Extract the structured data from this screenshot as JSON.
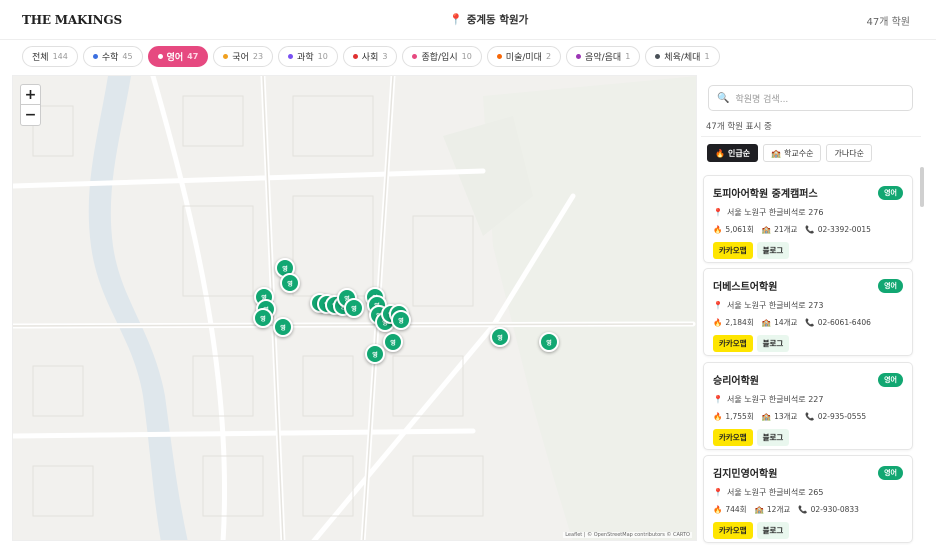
{
  "header": {
    "logo": "THE MAKINGS",
    "location": "중계동 학원가",
    "count": "47개 학원"
  },
  "filters": [
    {
      "label": "전체",
      "count": "144",
      "color": "",
      "active": false
    },
    {
      "label": "수학",
      "count": "45",
      "color": "#3b6fe0",
      "active": false
    },
    {
      "label": "영어",
      "count": "47",
      "color": "#12a772",
      "active": true
    },
    {
      "label": "국어",
      "count": "23",
      "color": "#f0a020",
      "active": false
    },
    {
      "label": "과학",
      "count": "10",
      "color": "#7950f2",
      "active": false
    },
    {
      "label": "사회",
      "count": "3",
      "color": "#e03131",
      "active": false
    },
    {
      "label": "종합/입시",
      "count": "10",
      "color": "#e64980",
      "active": false
    },
    {
      "label": "미술/미대",
      "count": "2",
      "color": "#f76707",
      "active": false
    },
    {
      "label": "음악/음대",
      "count": "1",
      "color": "#9c36b5",
      "active": false
    },
    {
      "label": "체육/체대",
      "count": "1",
      "color": "#495057",
      "active": false
    }
  ],
  "map": {
    "zoom_in": "+",
    "zoom_out": "−",
    "attribution": "Leaflet | © OpenStreetMap contributors © CARTO",
    "marker_label": "영",
    "marker_color": "#12a772"
  },
  "panel": {
    "search_placeholder": "학원명 검색...",
    "shown_text": "47개 학원 표시 중",
    "sorts": [
      {
        "icon": "🔥",
        "label": "인급순",
        "active": true
      },
      {
        "icon": "🏫",
        "label": "학교수순",
        "active": false
      },
      {
        "label": "가나다순",
        "active": false
      }
    ],
    "cards": [
      {
        "name": "토피아어학원 중계캠퍼스",
        "tag": "영어",
        "address": "서울 노원구 한글비석로 276",
        "views": "5,061회",
        "schools": "21개교",
        "phone": "02-3392-0015",
        "kakao": "카카오맵",
        "blog": "블로그"
      },
      {
        "name": "더베스트어학원",
        "tag": "영어",
        "address": "서울 노원구 한글비석로 273",
        "views": "2,184회",
        "schools": "14개교",
        "phone": "02-6061-6406",
        "kakao": "카카오맵",
        "blog": "블로그"
      },
      {
        "name": "승리어학원",
        "tag": "영어",
        "address": "서울 노원구 한글비석로 227",
        "views": "1,755회",
        "schools": "13개교",
        "phone": "02-935-0555",
        "kakao": "카카오맵",
        "blog": "블로그"
      },
      {
        "name": "김지민영어학원",
        "tag": "영어",
        "address": "서울 노원구 한글비석로 265",
        "views": "744회",
        "schools": "12개교",
        "phone": "02-930-0833",
        "kakao": "카카오맵",
        "blog": "블로그"
      }
    ]
  }
}
